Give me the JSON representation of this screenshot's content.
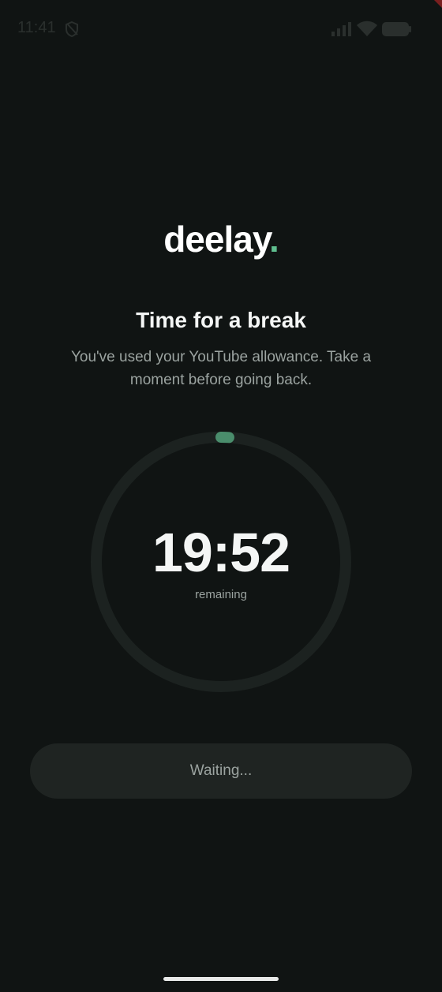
{
  "status_bar": {
    "time": "11:41",
    "icons": [
      "shield-icon",
      "signal-icon",
      "wifi-icon",
      "battery-icon"
    ]
  },
  "brand": {
    "name": "deelay",
    "dot": ".",
    "accent_color": "#5fbf8f"
  },
  "content": {
    "title": "Time for a break",
    "subtitle": "You've used your YouTube allowance. Take a moment before going back."
  },
  "timer": {
    "value": "19:52",
    "caption": "remaining",
    "progress_fraction": 0.01
  },
  "actions": {
    "waiting_label": "Waiting..."
  },
  "colors": {
    "background": "#101413",
    "ring_track": "#1c2220",
    "ring_progress": "#4a8d6c",
    "button_bg": "#1f2422"
  }
}
